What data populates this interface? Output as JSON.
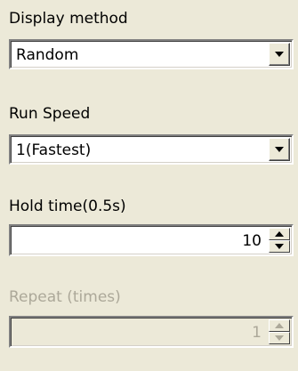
{
  "display_method": {
    "label": "Display method",
    "value": "Random",
    "icon": "chevron-down-icon"
  },
  "run_speed": {
    "label": "Run Speed",
    "value": "1(Fastest)",
    "icon": "chevron-down-icon"
  },
  "hold_time": {
    "label": "Hold time(0.5s)",
    "value": "10",
    "up_icon": "arrow-up-icon",
    "down_icon": "arrow-down-icon"
  },
  "repeat": {
    "label": "Repeat (times)",
    "value": "1",
    "enabled": false,
    "up_icon": "arrow-up-icon",
    "down_icon": "arrow-down-icon"
  },
  "colors": {
    "background": "#ece9d8",
    "disabled_text": "#aca899"
  }
}
